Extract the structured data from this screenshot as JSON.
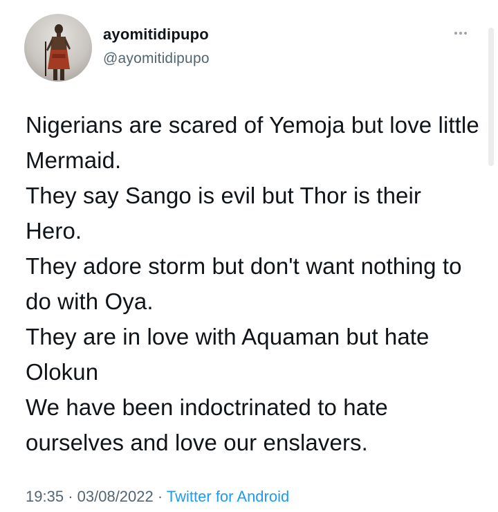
{
  "author": {
    "display_name": "ayomitidipupo",
    "handle": "@ayomitidipupo"
  },
  "more_icon": "more-horizontal-icon",
  "tweet": {
    "text": "Nigerians are scared of Yemoja but love little Mermaid.\nThey say Sango is evil but Thor is their Hero.\nThey adore storm but don't want nothing to do with Oya.\nThey are in love with Aquaman but hate Olokun\nWe have been indoctrinated to hate ourselves and love our enslavers."
  },
  "meta": {
    "time": "19:35",
    "separator": "·",
    "date": "03/08/2022",
    "source": "Twitter for Android"
  },
  "colors": {
    "text": "#0f1419",
    "secondary": "#536471",
    "link": "#1d9bf0",
    "background": "#ffffff"
  }
}
